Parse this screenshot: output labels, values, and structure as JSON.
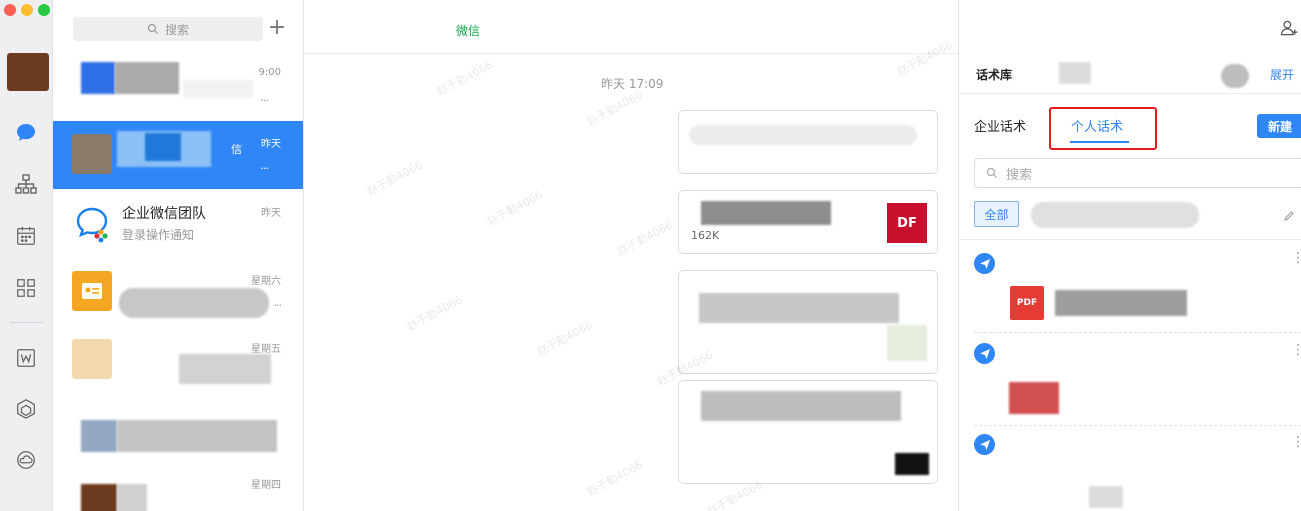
{
  "window": {
    "traffic_colors": [
      "#ff5f57",
      "#febc2e",
      "#28c840"
    ]
  },
  "rail": {
    "icons": [
      "message-icon",
      "org-chart-icon",
      "calendar-icon",
      "apps-grid-icon",
      "document-w-icon",
      "cube-icon",
      "cloud-drive-icon"
    ]
  },
  "chat_list": {
    "search_placeholder": "搜索",
    "items": [
      {
        "time": "9:00",
        "dots": "..."
      },
      {
        "tag": "信",
        "time": "昨天",
        "dots": "..."
      },
      {
        "name": "企业微信团队",
        "preview": "登录操作通知",
        "time": "昨天"
      },
      {
        "time": "星期六",
        "dots": "..."
      },
      {
        "time": "星期五"
      },
      {
        "time": ""
      },
      {
        "time": "星期四"
      }
    ]
  },
  "chat": {
    "header_tag": "微信",
    "day_stamp": "昨天 17:09",
    "file_size": "162K",
    "file_badge": "DF",
    "watermark": "赵于勤4066"
  },
  "panel": {
    "title": "话术库",
    "expand": "展开",
    "tab_corp": "企业话术",
    "tab_personal": "个人话术",
    "new_button": "新建",
    "search_placeholder": "搜索",
    "chip_all": "全部",
    "pdf_label": "PDF"
  },
  "colors": {
    "accent": "#2f86f6",
    "highlight": "#e21b1b",
    "wecom_green": "#17a34a"
  }
}
